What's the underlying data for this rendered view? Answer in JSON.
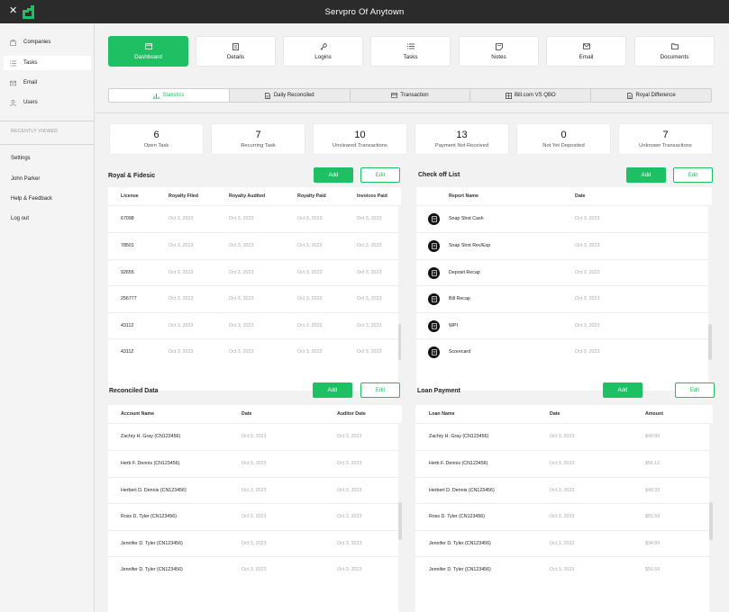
{
  "app": {
    "title": "Servpro Of Anytown",
    "close_glyph": "✕"
  },
  "sidebar": {
    "items": [
      {
        "label": "Companies",
        "icon": "briefcase-icon"
      },
      {
        "label": "Tasks",
        "icon": "list-icon"
      },
      {
        "label": "Email",
        "icon": "mail-icon"
      },
      {
        "label": "Users",
        "icon": "user-icon"
      }
    ],
    "recent_label": "RECENTLY VIEWED",
    "links": [
      "Settings",
      "John Parker",
      "Help & Feedback",
      "Log out"
    ]
  },
  "nav_tiles": [
    {
      "label": "Dashboard",
      "icon": "window-icon"
    },
    {
      "label": "Details",
      "icon": "document-icon"
    },
    {
      "label": "Logins",
      "icon": "key-icon"
    },
    {
      "label": "Tasks",
      "icon": "list-icon"
    },
    {
      "label": "Notes",
      "icon": "note-icon"
    },
    {
      "label": "Email",
      "icon": "mail-icon"
    },
    {
      "label": "Documents",
      "icon": "folder-icon"
    }
  ],
  "sub_tabs": [
    {
      "label": "Statistics",
      "icon": "chart-icon"
    },
    {
      "label": "Daily Reconciled",
      "icon": "file-icon"
    },
    {
      "label": "Transaction",
      "icon": "card-icon"
    },
    {
      "label": "Bill.com VS QBO",
      "icon": "grid-icon"
    },
    {
      "label": "Royal Difference",
      "icon": "file-icon"
    }
  ],
  "stats": [
    {
      "value": "6",
      "label": "Open Task"
    },
    {
      "value": "7",
      "label": "Recurring Task"
    },
    {
      "value": "10",
      "label": "Uncleared Transactions"
    },
    {
      "value": "13",
      "label": "Payment Not Received"
    },
    {
      "value": "0",
      "label": "Not Yet Deposited"
    },
    {
      "value": "7",
      "label": "Unknown Transactions"
    }
  ],
  "buttons": {
    "add": "Add",
    "edit": "Edit"
  },
  "royal": {
    "title": "Royal & Fidesic",
    "columns": [
      "License",
      "Royalty Filed",
      "Royalty Audited",
      "Royalty Paid",
      "Invoices Paid"
    ],
    "rows": [
      [
        "67098",
        "Oct 3, 2023",
        "Oct 3, 2023",
        "Oct 3, 2023",
        "Oct 3, 2023"
      ],
      [
        "78501",
        "Oct 3, 2023",
        "Oct 3, 2023",
        "Oct 3, 2023",
        "Oct 3, 2023"
      ],
      [
        "92655",
        "Oct 3, 2023",
        "Oct 3, 2023",
        "Oct 3, 2023",
        "Oct 3, 2023"
      ],
      [
        "256777",
        "Oct 3, 2023",
        "Oct 3, 2023",
        "Oct 3, 2023",
        "Oct 3, 2023"
      ],
      [
        "43112",
        "Oct 3, 2023",
        "Oct 3, 2023",
        "Oct 3, 2023",
        "Oct 3, 2023"
      ],
      [
        "43112",
        "Oct 3, 2023",
        "Oct 3, 2023",
        "Oct 3, 2023",
        "Oct 3, 2023"
      ]
    ]
  },
  "checkoff": {
    "title": "Check off List",
    "columns": [
      "Report Name",
      "Date"
    ],
    "rows": [
      [
        "Snap Shot Cash",
        "Oct 3, 2023"
      ],
      [
        "Snap Shot Rev/Exp",
        "Oct 3, 2023"
      ],
      [
        "Deposit Recap",
        "Oct 3, 2023"
      ],
      [
        "Bill Recap",
        "Oct 3, 2023"
      ],
      [
        "WPI",
        "Oct 3, 2023"
      ],
      [
        "Scorecard",
        "Oct 3, 2023"
      ]
    ]
  },
  "reconciled": {
    "title": "Reconciled Data",
    "columns": [
      "Account Name",
      "Date",
      "Auditor Date"
    ],
    "rows": [
      [
        "Zachry H. Gray (CN123456)",
        "Oct 3, 2023",
        "Oct 3, 2023"
      ],
      [
        "Herb F. Dennis (CN123456)",
        "Oct 3, 2023",
        "Oct 3, 2023"
      ],
      [
        "Herbert D. Dennis (CN123456)",
        "Oct 3, 2023",
        "Oct 3, 2023"
      ],
      [
        "Ross D. Tyler (CN123456)",
        "Oct 3, 2023",
        "Oct 3, 2023"
      ],
      [
        "Jennifer D. Tyler (CN123456)",
        "Oct 3, 2023",
        "Oct 3, 2023"
      ],
      [
        "Jennifer D. Tyler (CN123456)",
        "Oct 3, 2023",
        "Oct 3, 2023"
      ]
    ]
  },
  "loan": {
    "title": "Loan Payment",
    "columns": [
      "Loan Name",
      "Date",
      "Amount"
    ],
    "rows": [
      [
        "Zachry H. Gray (CN123456)",
        "Oct 3, 2023",
        "$49.89"
      ],
      [
        "Herb F. Dennis (CN123456)",
        "Oct 3, 2023",
        "$56.12"
      ],
      [
        "Herbert D. Dennis (CN123456)",
        "Oct 3, 2023",
        "$49.33"
      ],
      [
        "Ross D. Tyler (CN123456)",
        "Oct 3, 2023",
        "$55.59"
      ],
      [
        "Jennifer D. Tyler (CN123456)",
        "Oct 3, 2023",
        "$34.89"
      ],
      [
        "Jennifer D. Tyler (CN123456)",
        "Oct 3, 2023",
        "$55.59"
      ]
    ]
  },
  "colors": {
    "accent": "#1fbf64",
    "topbar": "#2b2b2b"
  }
}
